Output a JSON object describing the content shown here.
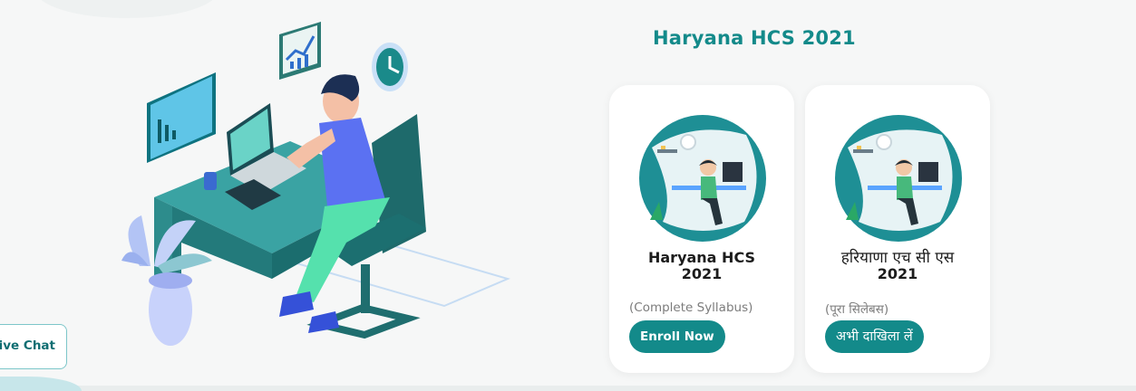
{
  "section": {
    "title": "Haryana HCS 2021"
  },
  "cards": [
    {
      "title_line1": "Haryana HCS",
      "title_line2": "2021",
      "subtitle": "(Complete Syllabus)",
      "button": "Enroll Now"
    },
    {
      "title_line1": "हरियाणा एच सी एस",
      "title_line2": "2021",
      "subtitle": "(पूरा सिलेबस)",
      "button": "अभी दाखिला लें"
    }
  ],
  "live_chat": {
    "label": "Live Chat"
  },
  "colors": {
    "brand_teal": "#138a8a",
    "accent_blue": "#5ba8e6",
    "card_bg": "#ffffff",
    "page_bg": "#f6f7f7"
  },
  "icons": {
    "illustration": "person-at-desk-illustration",
    "thumbnail": "student-studying-icon",
    "clock": "clock-icon",
    "chart": "bar-chart-icon"
  }
}
